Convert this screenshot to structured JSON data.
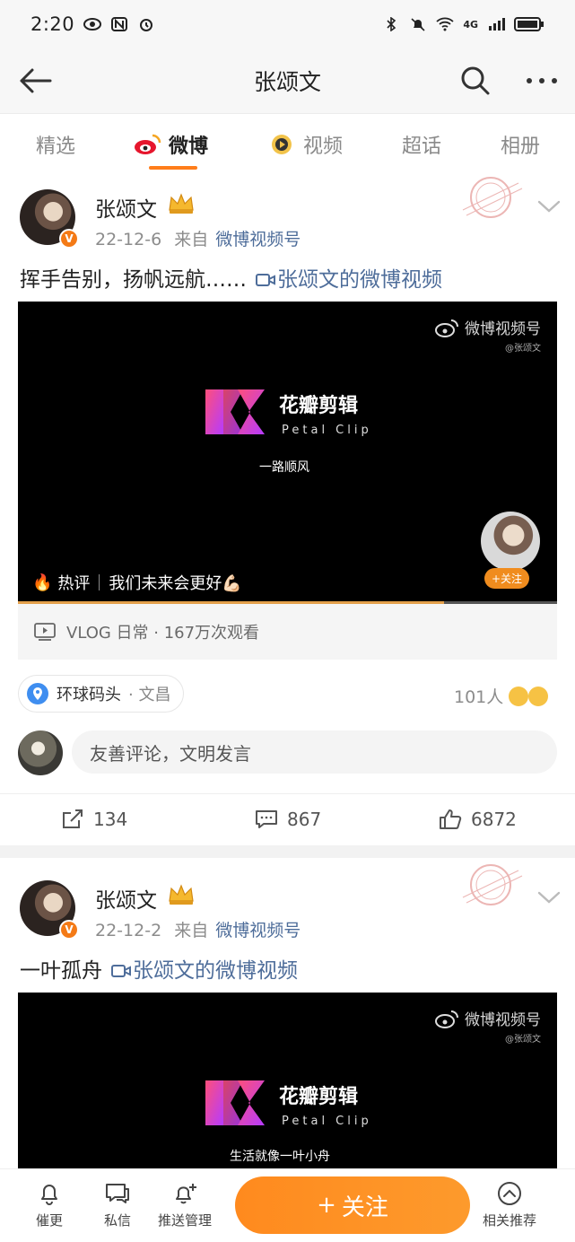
{
  "status_bar": {
    "time": "2:20",
    "network": "4G",
    "battery": "⚡"
  },
  "header": {
    "title": "张颂文"
  },
  "tabs": [
    "精选",
    "微博",
    "视频",
    "超话",
    "相册"
  ],
  "posts": [
    {
      "username": "张颂文",
      "date": "22-12-6",
      "from_label": "来自",
      "source": "微博视频号",
      "text": "挥手告别，扬帆远航……",
      "video_link": "张颂文的微博视频",
      "video": {
        "watermark": "微博视频号",
        "watermark_sub": "@张颂文",
        "clip_name": "花瓣剪辑",
        "clip_sub": "Petal Clip",
        "caption": "一路顺风",
        "hot_label": "热评",
        "hot_comment": "我们未来会更好💪🏻",
        "mini_follow": "+关注",
        "progress": 0.79
      },
      "vlog_label": "VLOG 日常 · 167万次观看",
      "location": "环球码头",
      "location_city": "· 文昌",
      "likers": "101人",
      "comment_placeholder": "友善评论，文明发言",
      "reposts": "134",
      "comments": "867",
      "likes": "6872"
    },
    {
      "username": "张颂文",
      "date": "22-12-2",
      "from_label": "来自",
      "source": "微博视频号",
      "text": "一叶孤舟",
      "video_link": "张颂文的微博视频",
      "video": {
        "watermark": "微博视频号",
        "watermark_sub": "@张颂文",
        "clip_name": "花瓣剪辑",
        "clip_sub": "Petal Clip",
        "caption": "生活就像一叶小舟"
      }
    }
  ],
  "bottom_bar": {
    "items": [
      "催更",
      "私信",
      "推送管理",
      "相关推荐"
    ],
    "follow_label": "关注",
    "follow_plus": "+"
  },
  "colors": {
    "accent": "#ff8a1e",
    "link": "#4e6d9a",
    "tab_underline": "#ff7d1a"
  }
}
